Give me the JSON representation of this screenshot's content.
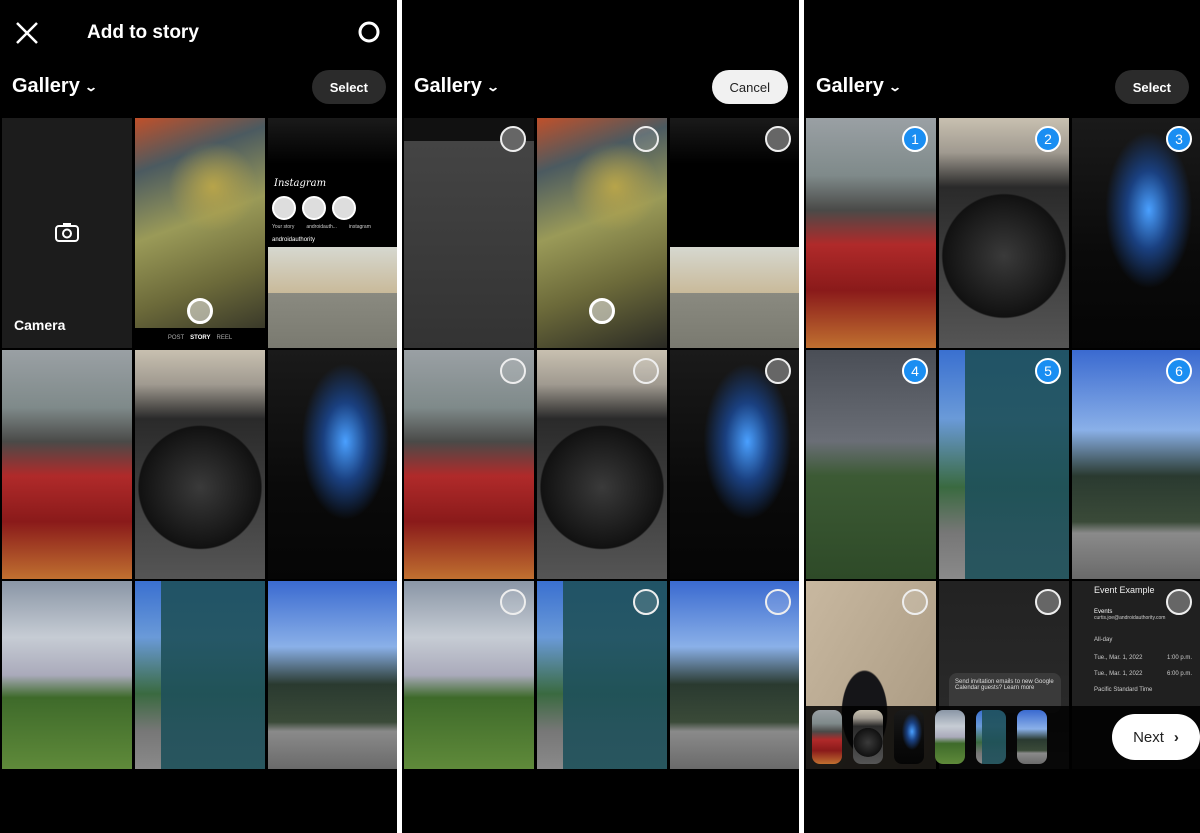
{
  "panel1": {
    "header": {
      "title": "Add to story"
    },
    "gallery_label": "Gallery",
    "select_label": "Select",
    "camera_label": "Camera",
    "camera_modes": [
      "POST",
      "STORY",
      "REEL"
    ],
    "instagram": {
      "logo": "Instagram",
      "stories": [
        "Your story",
        "androidauth...",
        "instagram"
      ],
      "account": "androidauthority"
    }
  },
  "panel2": {
    "gallery_label": "Gallery",
    "cancel_label": "Cancel"
  },
  "panel3": {
    "gallery_label": "Gallery",
    "select_label": "Select",
    "selection_numbers": [
      "1",
      "2",
      "3",
      "4",
      "5",
      "6"
    ],
    "dialog_text": "Send invitation emails to new Google Calendar guests? Learn more",
    "event": {
      "title": "Event Example",
      "calendar": "Events",
      "email": "curtis.joe@androidauthority.com",
      "all_day": "All-day",
      "start_date": "Tue., Mar. 1, 2022",
      "start_time": "1:00 p.m.",
      "end_date": "Tue., Mar. 1, 2022",
      "end_time": "6:00 p.m.",
      "timezone": "Pacific Standard Time"
    },
    "next_label": "Next"
  },
  "colors": {
    "background": "#000000",
    "selection_badge": "#1a8ef2",
    "pill": "#2b2b2b"
  }
}
